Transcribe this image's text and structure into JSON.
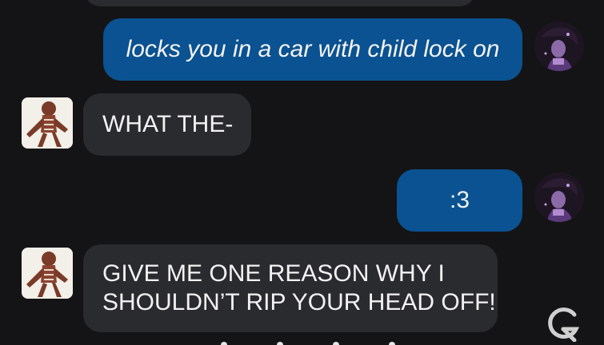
{
  "messages": [
    {
      "sender": "user",
      "text": "locks you in a car with child lock on",
      "italic": true
    },
    {
      "sender": "bot",
      "text": "WHAT THE-"
    },
    {
      "sender": "user",
      "text": ":3"
    },
    {
      "sender": "bot",
      "text": "GIVE ME ONE REASON WHY I\nSHOULDN’T RIP YOUR HEAD OFF!"
    }
  ],
  "colors": {
    "background": "#141416",
    "user_bubble": "#0a5291",
    "bot_bubble": "#2a2b2f",
    "text": "#f2f2f2"
  },
  "icons": {
    "user_avatar": "purple-character-avatar",
    "bot_avatar": "gingerbread-figure-avatar",
    "corner": "g-logo-icon"
  }
}
